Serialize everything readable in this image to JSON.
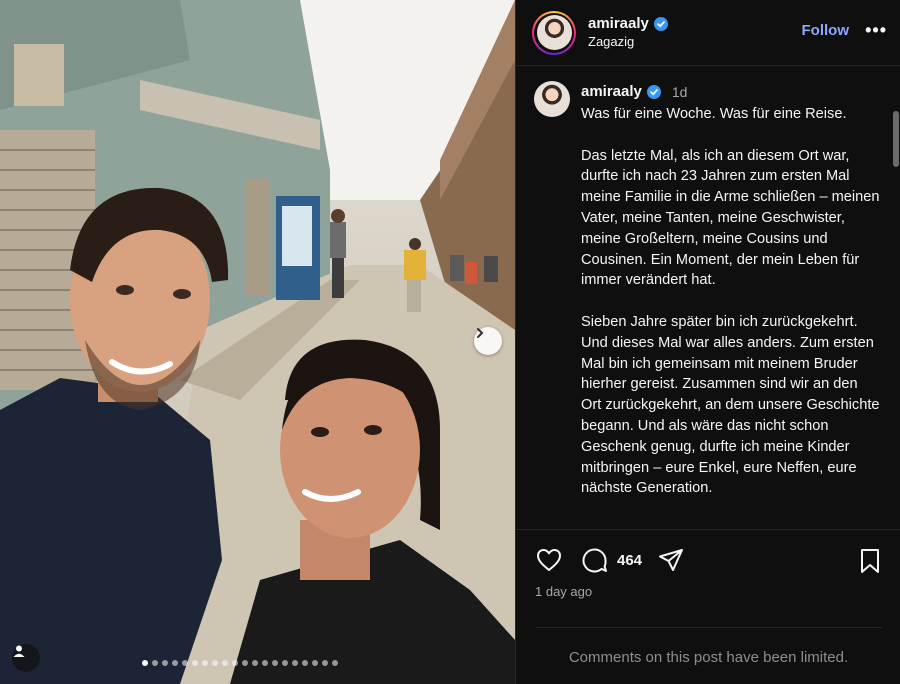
{
  "header": {
    "username": "amiraaly",
    "location": "Zagazig",
    "follow_label": "Follow",
    "more_label": "•••"
  },
  "caption": {
    "username": "amiraaly",
    "time": "1d",
    "paragraphs": [
      "Was für eine Woche. Was für eine Reise.",
      "Das letzte Mal, als ich an diesem Ort war, durfte ich nach 23 Jahren zum ersten Mal meine Familie in die Arme schließen – meinen Vater, meine Tanten, meine Geschwister, meine Großeltern, meine Cousins und Cousinen. Ein Moment, der mein Leben für immer verändert hat.",
      "Sieben Jahre später bin ich zurückgekehrt. Und dieses Mal war alles anders. Zum ersten Mal bin ich gemeinsam mit meinem Bruder hierher gereist. Zusammen sind wir an den Ort zurückgekehrt, an dem unsere Geschichte begann. Und als wäre das nicht schon Geschenk genug, durfte ich meine Kinder mitbringen – eure Enkel, eure Neffen, eure nächste Generation."
    ]
  },
  "actions": {
    "comment_count": "464",
    "icons": [
      "heart-icon",
      "comment-icon",
      "share-icon",
      "bookmark-icon"
    ]
  },
  "timestamp": "1 day ago",
  "comments_notice": "Comments on this post have been limited.",
  "carousel": {
    "total_slides": 20,
    "active_index": 0
  },
  "colors": {
    "follow": "#8ca8ff",
    "verified": "#3897f0",
    "panel_bg": "#0f0f0f"
  }
}
